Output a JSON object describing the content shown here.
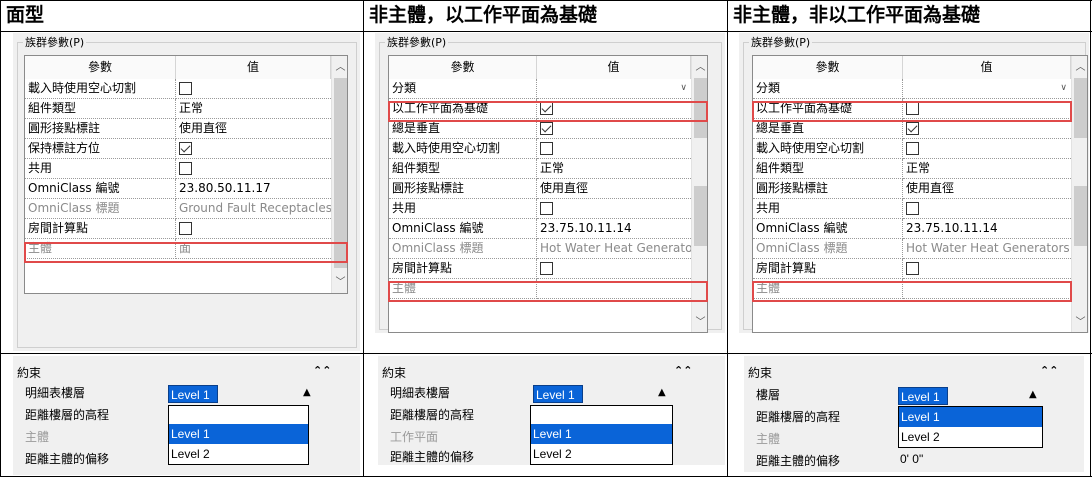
{
  "headers": [
    "面型",
    "非主體，以工作平面為基礎",
    "非主體，非以工作平面為基礎"
  ],
  "group_title": "族群參數(P)",
  "table_headers": {
    "param": "參數",
    "value": "值"
  },
  "panel1": {
    "rows": [
      {
        "label": "載入時使用空心切割",
        "value": "",
        "checkbox": false
      },
      {
        "label": "組件類型",
        "value": "正常"
      },
      {
        "label": "圓形接點標註",
        "value": "使用直徑"
      },
      {
        "label": "保持標註方位",
        "value": "",
        "checkbox": true
      },
      {
        "label": "共用",
        "value": "",
        "checkbox": false
      },
      {
        "label": "OmniClass 編號",
        "value": "23.80.50.11.17"
      },
      {
        "label": "OmniClass 標題",
        "value": "Ground Fault Receptacles",
        "dim": true
      },
      {
        "label": "房間計算點",
        "value": "",
        "checkbox": false
      },
      {
        "label": "主體",
        "value": "面",
        "dim": true
      }
    ]
  },
  "panel2": {
    "rows": [
      {
        "label": "分類",
        "value": "",
        "dropdown": true
      },
      {
        "label": "以工作平面為基礎",
        "value": "",
        "checkbox": true
      },
      {
        "label": "總是垂直",
        "value": "",
        "checkbox": true
      },
      {
        "label": "載入時使用空心切割",
        "value": "",
        "checkbox": false
      },
      {
        "label": "組件類型",
        "value": "正常"
      },
      {
        "label": "圓形接點標註",
        "value": "使用直徑"
      },
      {
        "label": "共用",
        "value": "",
        "checkbox": false
      },
      {
        "label": "OmniClass 編號",
        "value": "23.75.10.11.14"
      },
      {
        "label": "OmniClass 標題",
        "value": "Hot Water Heat Generators",
        "dim": true
      },
      {
        "label": "房間計算點",
        "value": "",
        "checkbox": false
      },
      {
        "label": "主體",
        "value": "",
        "dim": true
      }
    ]
  },
  "panel3": {
    "rows": [
      {
        "label": "分類",
        "value": "",
        "dropdown": true
      },
      {
        "label": "以工作平面為基礎",
        "value": "",
        "checkbox": false
      },
      {
        "label": "總是垂直",
        "value": "",
        "checkbox": true
      },
      {
        "label": "載入時使用空心切割",
        "value": "",
        "checkbox": false
      },
      {
        "label": "組件類型",
        "value": "正常"
      },
      {
        "label": "圓形接點標註",
        "value": "使用直徑"
      },
      {
        "label": "共用",
        "value": "",
        "checkbox": false
      },
      {
        "label": "OmniClass 編號",
        "value": "23.75.10.11.14"
      },
      {
        "label": "OmniClass 標題",
        "value": "Hot Water Heat Generators",
        "dim": true
      },
      {
        "label": "房間計算點",
        "value": "",
        "checkbox": false
      },
      {
        "label": "主體",
        "value": "",
        "dim": true
      }
    ]
  },
  "constraints": {
    "title": "約束",
    "p1": {
      "labels": [
        "明細表樓層",
        "距離樓層的高程",
        "主體",
        "距離主體的偏移"
      ],
      "selected": "Level 1",
      "options": [
        "Level 1",
        "Level 2"
      ]
    },
    "p2": {
      "labels": [
        "明細表樓層",
        "距離樓層的高程",
        "工作平面",
        "距離主體的偏移"
      ],
      "selected": "Level 1",
      "options": [
        "Level 1",
        "Level 2"
      ]
    },
    "p3": {
      "labels": [
        "樓層",
        "距離樓層的高程",
        "主體",
        "距離主體的偏移"
      ],
      "selected": "Level 1",
      "options": [
        "Level 1",
        "Level 2"
      ],
      "offset": "0'  0\""
    }
  },
  "colors": {
    "highlight": "#e04a4a",
    "selection": "#0a64d8"
  }
}
